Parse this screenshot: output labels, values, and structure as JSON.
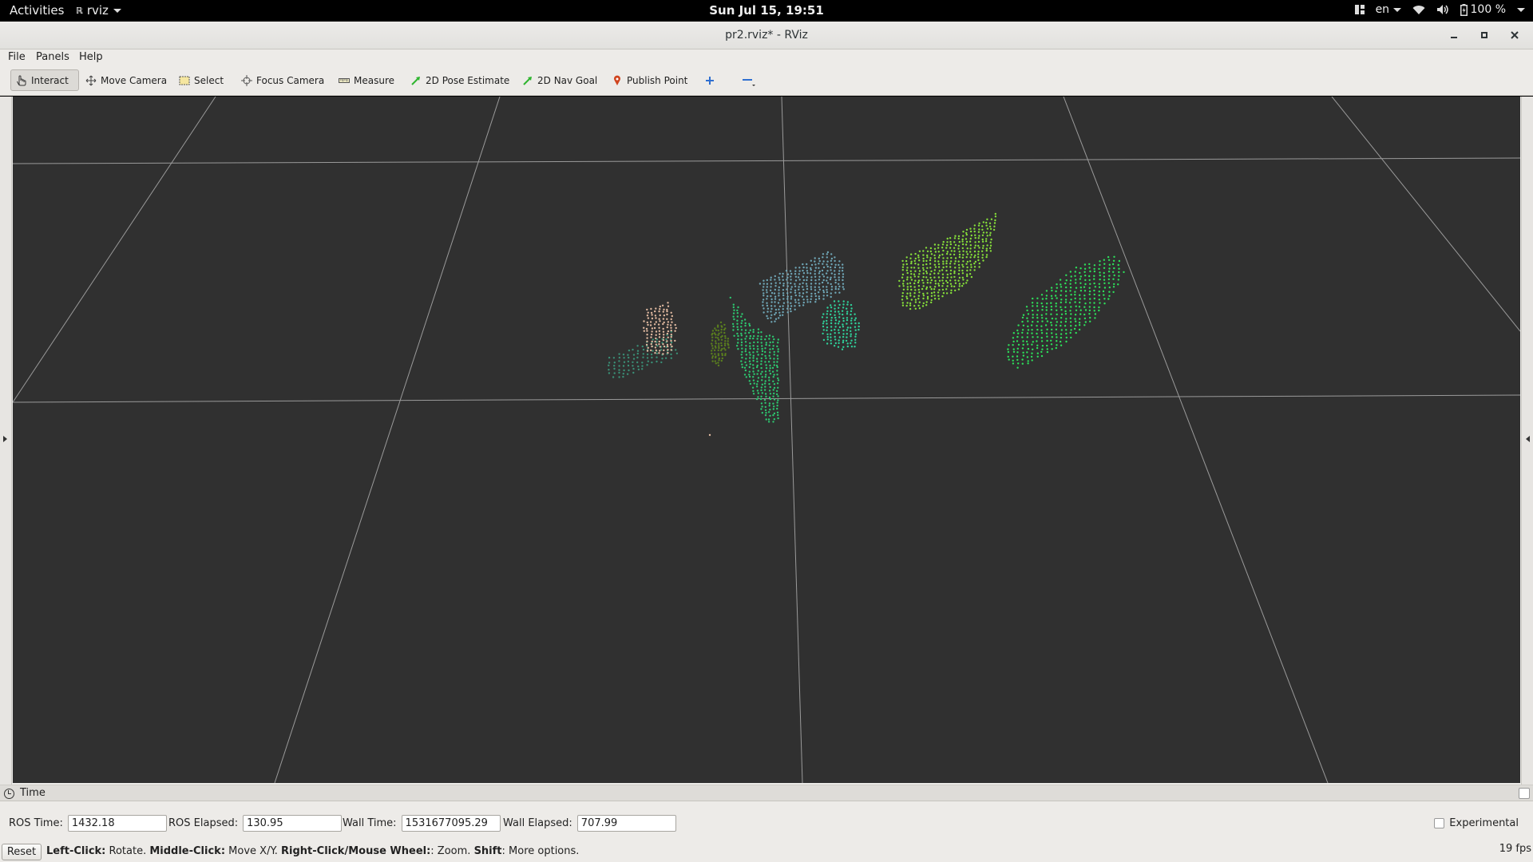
{
  "topbar": {
    "activities": "Activities",
    "app_name": "rviz",
    "app_icon_text": "ℝ",
    "clock": "Sun Jul 15, 19:51",
    "language": "en",
    "battery": "100 %",
    "icons": [
      "tiling-icon",
      "wifi-icon",
      "volume-icon",
      "battery-icon"
    ]
  },
  "window": {
    "title": "pr2.rviz* - RViz"
  },
  "menubar": {
    "file": "File",
    "panels": "Panels",
    "help": "Help"
  },
  "toolbar": {
    "interact": "Interact",
    "move_camera": "Move Camera",
    "select": "Select",
    "focus_camera": "Focus Camera",
    "measure": "Measure",
    "pose_estimate": "2D Pose Estimate",
    "nav_goal": "2D Nav Goal",
    "publish_point": "Publish Point"
  },
  "time_panel": {
    "title": "Time",
    "ros_time_label": "ROS Time:",
    "ros_time": "1432.18",
    "ros_elapsed_label": "ROS Elapsed:",
    "ros_elapsed": "130.95",
    "wall_time_label": "Wall Time:",
    "wall_time": "1531677095.29",
    "wall_elapsed_label": "Wall Elapsed:",
    "wall_elapsed": "707.99",
    "experimental_label": "Experimental",
    "experimental_checked": false
  },
  "statusbar": {
    "reset": "Reset",
    "hint_parts": [
      {
        "text": "Left-Click:",
        "bold": true
      },
      {
        "text": " Rotate. ",
        "bold": false
      },
      {
        "text": "Middle-Click:",
        "bold": true
      },
      {
        "text": " Move X/Y. ",
        "bold": false
      },
      {
        "text": "Right-Click/Mouse Wheel:",
        "bold": true
      },
      {
        "text": ": Zoom. ",
        "bold": false
      },
      {
        "text": "Shift",
        "bold": true
      },
      {
        "text": ": More options.",
        "bold": false
      }
    ],
    "fps": "19 fps"
  },
  "scene": {
    "background": "#303030",
    "grid_color": "#a0a0a0",
    "clusters": [
      {
        "name": "cluster-teal-small",
        "color": "#3a8f76"
      },
      {
        "name": "cluster-olive",
        "color": "#5a7f1e"
      },
      {
        "name": "cluster-green-upright",
        "color": "#2dc870"
      },
      {
        "name": "cluster-lightblue",
        "color": "#6fa6b6"
      },
      {
        "name": "cluster-peach",
        "color": "#e0b9a0"
      },
      {
        "name": "cluster-teal-round",
        "color": "#2fd19a"
      },
      {
        "name": "cluster-lime",
        "color": "#86e03a"
      },
      {
        "name": "cluster-bright-green",
        "color": "#2de05a"
      }
    ]
  }
}
